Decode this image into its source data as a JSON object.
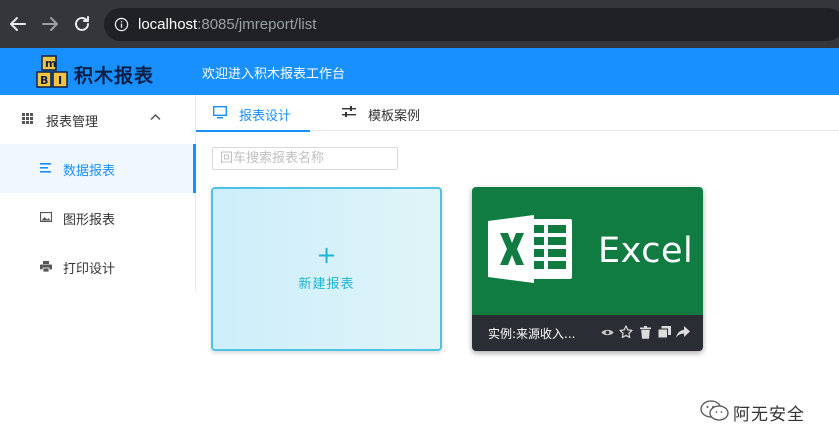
{
  "browser": {
    "url_host": "localhost",
    "url_rest": ":8085/jmreport/list"
  },
  "header": {
    "logo_text": "积木报表",
    "welcome": "欢迎进入积木报表工作台"
  },
  "sidebar": {
    "group_label": "报表管理",
    "items": [
      {
        "label": "数据报表",
        "icon": "list-icon",
        "active": true
      },
      {
        "label": "图形报表",
        "icon": "image-icon",
        "active": false
      },
      {
        "label": "打印设计",
        "icon": "printer-icon",
        "active": false
      }
    ]
  },
  "tabs": [
    {
      "label": "报表设计",
      "icon": "monitor-icon",
      "active": true
    },
    {
      "label": "模板案例",
      "icon": "sliders-icon",
      "active": false
    }
  ],
  "search": {
    "placeholder": "回车搜索报表名称"
  },
  "new_card": {
    "plus": "+",
    "label": "新建报表"
  },
  "excel_card": {
    "brand": "Excel",
    "name": "实例:来源收入...",
    "actions": [
      "eye-icon",
      "star-icon",
      "trash-icon",
      "copy-icon",
      "share-icon"
    ]
  },
  "watermark": {
    "text": "阿无安全"
  },
  "colors": {
    "primary": "#1890ff",
    "excel_green": "#107c41",
    "card_accent": "#1cb5d6"
  }
}
